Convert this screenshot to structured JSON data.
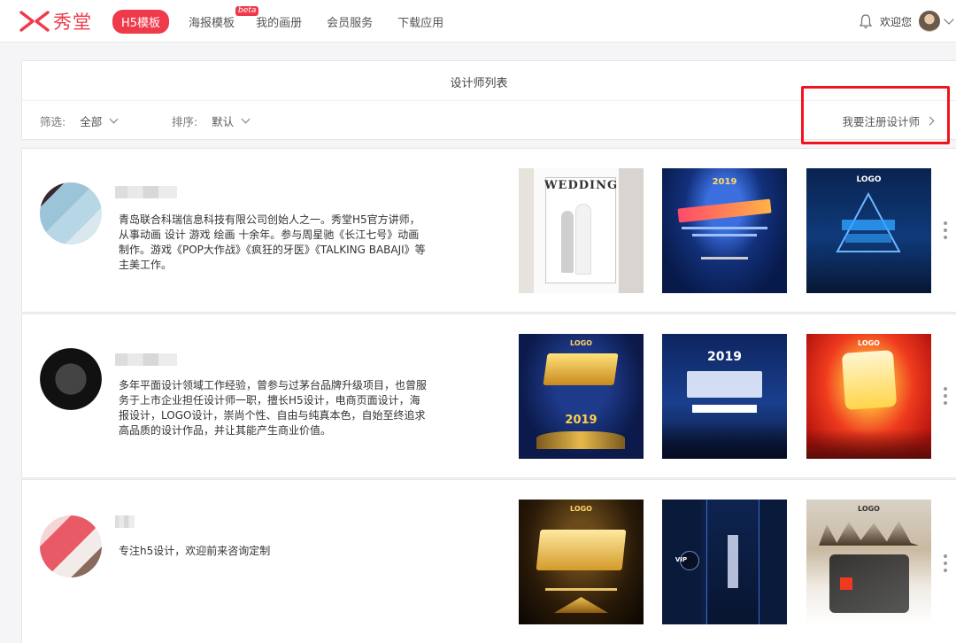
{
  "header": {
    "logo_text": "秀堂",
    "nav": [
      {
        "label": "H5模板"
      },
      {
        "label": "海报模板"
      },
      {
        "label": "我的画册"
      },
      {
        "label": "会员服务"
      },
      {
        "label": "下载应用"
      }
    ],
    "beta_badge": "beta",
    "welcome": "欢迎您",
    "accent_color": "#ef3a4b"
  },
  "panel": {
    "title": "设计师列表",
    "filter_label": "筛选:",
    "filter_value": "全部",
    "sort_label": "排序:",
    "sort_value": "默认",
    "register_link": "我要注册设计师"
  },
  "designers": [
    {
      "bio": "青岛联合科瑞信息科技有限公司创始人之一。秀堂H5官方讲师，从事动画 设计 游戏 绘画 十余年。参与周星驰《长江七号》动画制作。游戏《POP大作战》《疯狂的牙医》《TALKING BABAJI》等 主美工作。",
      "works": [
        {
          "caption": "WEDDING"
        },
        {
          "caption": "2019"
        },
        {
          "caption": "LOGO"
        }
      ]
    },
    {
      "bio": "多年平面设计领域工作经验，曾参与过茅台品牌升级项目，也曾服务于上市企业担任设计师一职，擅长H5设计，电商页面设计，海报设计，LOGO设计，崇尚个性、自由与纯真本色，自始至终追求高品质的设计作品，并让其能产生商业价值。",
      "works": [
        {
          "caption": "2019"
        },
        {
          "caption": "2019"
        },
        {
          "caption": "LOGO"
        }
      ]
    },
    {
      "bio": "专注h5设计，欢迎前来咨询定制",
      "works": [
        {
          "caption": "LOGO"
        },
        {
          "caption": "VIP"
        },
        {
          "caption": "LOGO"
        }
      ]
    }
  ]
}
